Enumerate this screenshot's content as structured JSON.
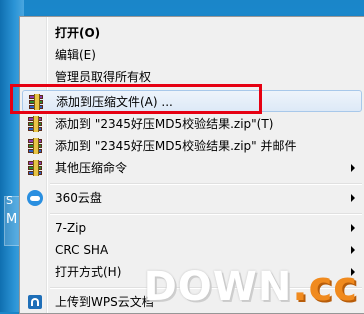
{
  "menu": {
    "items": [
      {
        "label": "打开(O)",
        "bold": true,
        "icon": "",
        "submenu": false
      },
      {
        "label": "编辑(E)",
        "bold": false,
        "icon": "",
        "submenu": false
      },
      {
        "label": "管理员取得所有权",
        "bold": false,
        "icon": "",
        "submenu": false
      },
      {
        "label": "添加到压缩文件(A) ...",
        "bold": false,
        "icon": "winrar-icon",
        "submenu": false,
        "highlighted": true
      },
      {
        "label": "添加到 \"2345好压MD5校验结果.zip\"(T)",
        "bold": false,
        "icon": "winrar-icon",
        "submenu": false
      },
      {
        "label": "添加到 \"2345好压MD5校验结果.zip\" 并邮件",
        "bold": false,
        "icon": "winrar-icon",
        "submenu": false
      },
      {
        "label": "其他压缩命令",
        "bold": false,
        "icon": "winrar-icon",
        "submenu": true
      },
      {
        "label": "360云盘",
        "bold": false,
        "icon": "360-cloud-icon",
        "submenu": true
      },
      {
        "label": "7-Zip",
        "bold": false,
        "icon": "",
        "submenu": true
      },
      {
        "label": "CRC SHA",
        "bold": false,
        "icon": "",
        "submenu": true
      },
      {
        "label": "打开方式(H)",
        "bold": false,
        "icon": "",
        "submenu": true
      },
      {
        "label": "上传到WPS云文档",
        "bold": false,
        "icon": "wps-cloud-icon",
        "submenu": false
      }
    ]
  },
  "desktop": {
    "icon_text_top": "S",
    "icon_text_bottom": "M"
  },
  "watermark": {
    "main": "DOWN",
    "suffix": ".cc"
  },
  "colors": {
    "highlight_box": "#e60012",
    "menu_bg": "#f0f0f0",
    "desktop": "#1f8fd2"
  }
}
